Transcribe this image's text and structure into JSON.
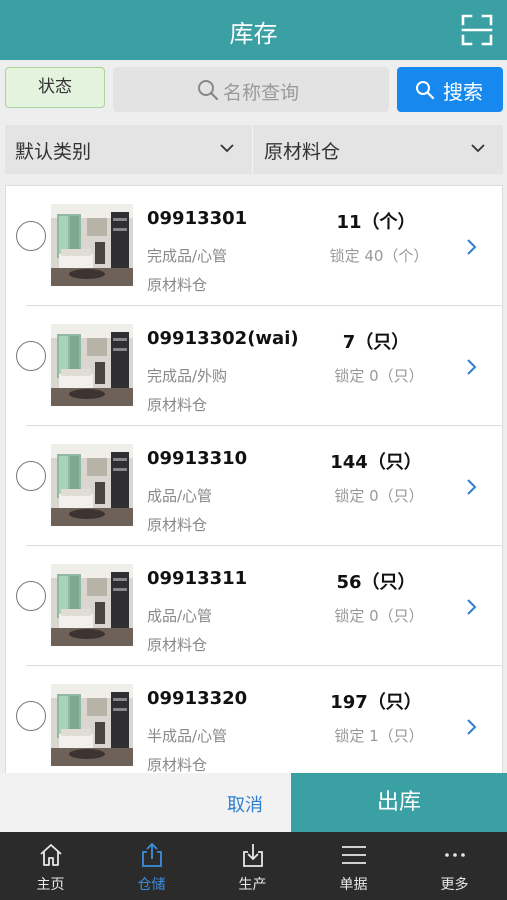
{
  "header": {
    "title": "库存",
    "scan_icon": "scan-icon"
  },
  "filters": {
    "status_label": "状态",
    "search_placeholder": "名称查询",
    "search_button": "搜索",
    "category": "默认类别",
    "warehouse": "原材料仓"
  },
  "items": [
    {
      "code": "09913301",
      "qty": "11（个）",
      "category": "完成品/心管",
      "locked": "锁定 40（个）",
      "warehouse": "原材料仓"
    },
    {
      "code": "09913302(wai)",
      "qty": "7（只）",
      "category": "完成品/外购",
      "locked": "锁定 0（只）",
      "warehouse": "原材料仓"
    },
    {
      "code": "09913310",
      "qty": "144（只）",
      "category": "成品/心管",
      "locked": "锁定 0（只）",
      "warehouse": "原材料仓"
    },
    {
      "code": "09913311",
      "qty": "56（只）",
      "category": "成品/心管",
      "locked": "锁定 0（只）",
      "warehouse": "原材料仓"
    },
    {
      "code": "09913320",
      "qty": "197（只）",
      "category": "半成品/心管",
      "locked": "锁定 1（只）",
      "warehouse": "原材料仓"
    }
  ],
  "actions": {
    "cancel": "取消",
    "outbound": "出库"
  },
  "tabs": [
    {
      "label": "主页",
      "icon": "home-icon",
      "active": false
    },
    {
      "label": "仓储",
      "icon": "upload-icon",
      "active": true
    },
    {
      "label": "生产",
      "icon": "download-icon",
      "active": false
    },
    {
      "label": "单据",
      "icon": "list-icon",
      "active": false
    },
    {
      "label": "更多",
      "icon": "more-icon",
      "active": false
    }
  ],
  "colors": {
    "header": "#3aa0a4",
    "accent": "#1789ee",
    "tab_active": "#3b8fe0",
    "tabbar": "#2b2b2b"
  }
}
